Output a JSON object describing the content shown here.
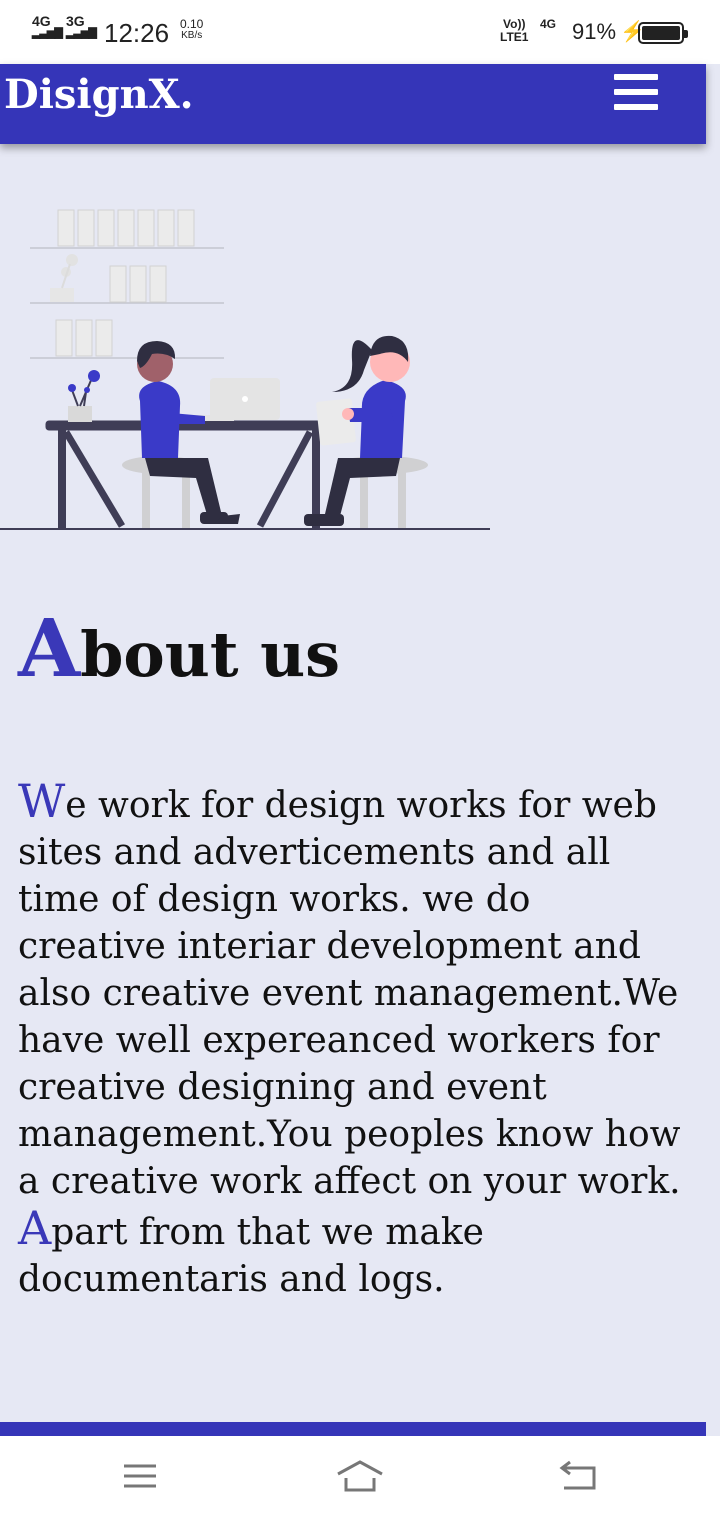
{
  "status_bar": {
    "net1": "4G",
    "net2": "3G",
    "time": "12:26",
    "speed_value": "0.10",
    "speed_unit": "KB/s",
    "volte_top": "Vo))",
    "volte_bottom": "LTE1",
    "net3": "4G",
    "battery": "91%"
  },
  "header": {
    "brand": "DisignX.",
    "menu_icon": "hamburger-menu-icon",
    "background": "#3535b8"
  },
  "about": {
    "title_first": "A",
    "title_rest": "bout us",
    "para1_first": "W",
    "para1_rest": "e work for design works for web sites and adverticements and all time of design works. we do creative interiar development and also creative event management.We have well expereanced workers for creative designing and event management.You peoples know how a creative work affect on your work.",
    "para2_first": "A",
    "para2_rest": "part from that we make documentaris and logs.",
    "accent_color": "#3a38b8"
  },
  "nav_bar": {
    "recents_icon": "recents-icon",
    "home_icon": "home-icon",
    "back_icon": "back-icon"
  }
}
